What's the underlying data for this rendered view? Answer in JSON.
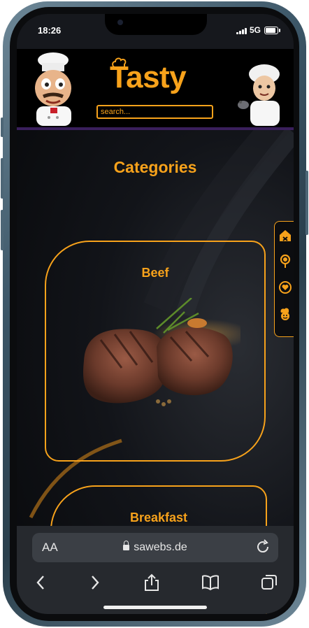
{
  "status": {
    "time": "18:26",
    "network": "5G",
    "battery_level": 0.9
  },
  "header": {
    "logo": "Tasty",
    "search_placeholder": "search..."
  },
  "main": {
    "title": "Categories",
    "categories": [
      {
        "label": "Beef"
      },
      {
        "label": "Breakfast"
      }
    ]
  },
  "side_menu": {
    "icons": [
      "home-icon",
      "pan-icon",
      "heart-icon",
      "chef-icon"
    ]
  },
  "browser": {
    "aa_label": "AA",
    "url": "sawebs.de"
  },
  "colors": {
    "accent": "#f7a21b",
    "header_border": "#3a1f5c",
    "bar_bg": "#26292e"
  }
}
